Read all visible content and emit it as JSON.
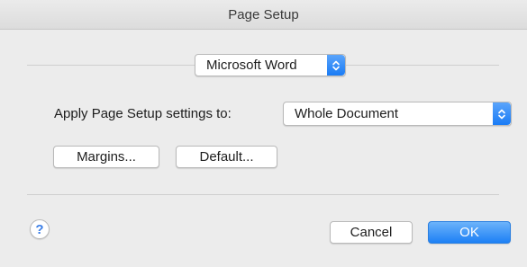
{
  "window": {
    "title": "Page Setup"
  },
  "app_popup": {
    "value": "Microsoft Word"
  },
  "apply_settings": {
    "label": "Apply Page Setup settings to:",
    "value": "Whole Document"
  },
  "buttons": {
    "margins": "Margins...",
    "default": "Default...",
    "cancel": "Cancel",
    "ok": "OK",
    "help": "?"
  },
  "colors": {
    "accent": "#1a7cf5",
    "window_bg": "#ececec"
  },
  "icons": {
    "stepper": "up-down-chevron-icon",
    "help": "question-mark-icon"
  }
}
